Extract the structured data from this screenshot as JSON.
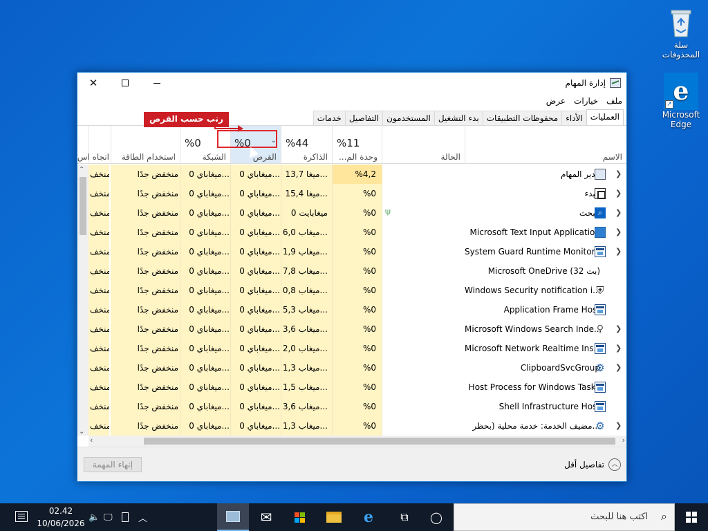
{
  "desktop": {
    "recycle_bin": "سلة المحذوفات",
    "edge_line1": "Microsoft",
    "edge_line2": "Edge"
  },
  "window": {
    "title": "إدارة المهام",
    "menu": [
      "ملف",
      "خيارات",
      "عرض"
    ],
    "tabs": [
      "العمليات",
      "الأداء",
      "محفوظات التطبيقات",
      "بدء التشغيل",
      "المستخدمون",
      "التفاصيل",
      "خدمات"
    ],
    "active_tab": "العمليات",
    "tooltip": "رتب حسب القرص"
  },
  "columns": {
    "name": "الاسم",
    "status": "الحالة",
    "cpu_pct": "%11",
    "cpu": "وحدة الم...",
    "mem_pct": "%44",
    "mem": "الذاكرة",
    "disk_pct": "%0",
    "disk": "القرص",
    "net_pct": "%0",
    "net": "الشبكة",
    "power": "استخدام الطاقة",
    "power_trend": "اتجاه اس"
  },
  "rows": [
    {
      "name": "مدير المهام",
      "icon": "task-manager-icon",
      "expand": true,
      "cpu": "%4,2",
      "mem": "13,7 ميغا...",
      "disk": "0 ميغاباي...",
      "net": "0 ميغاباي...",
      "power": "منخفض جدًا",
      "trend": "منخف"
    },
    {
      "name": "البدء",
      "icon": "start-icon",
      "expand": true,
      "cpu": "%0",
      "mem": "15,4 ميغا...",
      "disk": "0 ميغاباي...",
      "net": "0 ميغاباي...",
      "power": "منخفض جدًا",
      "trend": "منخف"
    },
    {
      "name": "البحث",
      "icon": "search-icon",
      "expand": true,
      "leaf": true,
      "cpu": "%0",
      "mem": "0 ميغابايت",
      "disk": "0 ميغاباي...",
      "net": "0 ميغاباي...",
      "power": "منخفض جدًا",
      "trend": "منخف"
    },
    {
      "name": "Microsoft Text Input Application",
      "icon": "keyboard-icon",
      "expand": true,
      "cpu": "%0",
      "mem": "6,0 ميغاب...",
      "disk": "0 ميغاباي...",
      "net": "0 ميغاباي...",
      "power": "منخفض جدًا",
      "trend": "منخف"
    },
    {
      "name": "System Guard Runtime Monitor...",
      "icon": "app-icon",
      "expand": true,
      "cpu": "%0",
      "mem": "1,9 ميغاب...",
      "disk": "0 ميغاباي...",
      "net": "0 ميغاباي...",
      "power": "منخفض جدًا",
      "trend": "منخف"
    },
    {
      "name": "Microsoft OneDrive (32 بت)",
      "icon": "",
      "expand": false,
      "cpu": "%0",
      "mem": "7,8 ميغاب...",
      "disk": "0 ميغاباي...",
      "net": "0 ميغاباي...",
      "power": "منخفض جدًا",
      "trend": "منخف"
    },
    {
      "name": "Windows Security notification i...",
      "icon": "shield-icon",
      "expand": false,
      "cpu": "%0",
      "mem": "0,8 ميغاب...",
      "disk": "0 ميغاباي...",
      "net": "0 ميغاباي...",
      "power": "منخفض جدًا",
      "trend": "منخف"
    },
    {
      "name": "Application Frame Host",
      "icon": "app-icon",
      "expand": false,
      "cpu": "%0",
      "mem": "5,3 ميغاب...",
      "disk": "0 ميغاباي...",
      "net": "0 ميغاباي...",
      "power": "منخفض جدًا",
      "trend": "منخف"
    },
    {
      "name": "Microsoft Windows Search Inde...",
      "icon": "magnifier-icon",
      "expand": true,
      "cpu": "%0",
      "mem": "3,6 ميغاب...",
      "disk": "0 ميغاباي...",
      "net": "0 ميغاباي...",
      "power": "منخفض جدًا",
      "trend": "منخف"
    },
    {
      "name": "Microsoft Network Realtime Ins...",
      "icon": "app-icon",
      "expand": true,
      "cpu": "%0",
      "mem": "2,0 ميغاب...",
      "disk": "0 ميغاباي...",
      "net": "0 ميغاباي...",
      "power": "منخفض جدًا",
      "trend": "منخف"
    },
    {
      "name": "ClipboardSvcGroup",
      "icon": "gear-icon",
      "expand": true,
      "cpu": "%0",
      "mem": "1,3 ميغاب...",
      "disk": "0 ميغاباي...",
      "net": "0 ميغاباي...",
      "power": "منخفض جدًا",
      "trend": "منخف"
    },
    {
      "name": "Host Process for Windows Tasks",
      "icon": "app-icon",
      "expand": false,
      "cpu": "%0",
      "mem": "1,5 ميغاب...",
      "disk": "0 ميغاباي...",
      "net": "0 ميغاباي...",
      "power": "منخفض جدًا",
      "trend": "منخف"
    },
    {
      "name": "Shell Infrastructure Host",
      "icon": "app-icon",
      "expand": false,
      "cpu": "%0",
      "mem": "3,6 ميغاب...",
      "disk": "0 ميغاباي...",
      "net": "0 ميغاباي...",
      "power": "منخفض جدًا",
      "trend": "منخف"
    },
    {
      "name": "مضيف الخدمة: خدمة محلية (بحظر...",
      "icon": "gear-icon",
      "expand": true,
      "cpu": "%0",
      "mem": "1,3 ميغاب...",
      "disk": "0 ميغاباي...",
      "net": "0 ميغاباي...",
      "power": "منخفض جدًا",
      "trend": "منخف"
    }
  ],
  "footer": {
    "end_task": "إنهاء المهمة",
    "fewer_details": "تفاصيل أقل"
  },
  "taskbar": {
    "search_placeholder": "اكتب هنا للبحث",
    "time": "02.42",
    "date": "10/06/2026"
  }
}
